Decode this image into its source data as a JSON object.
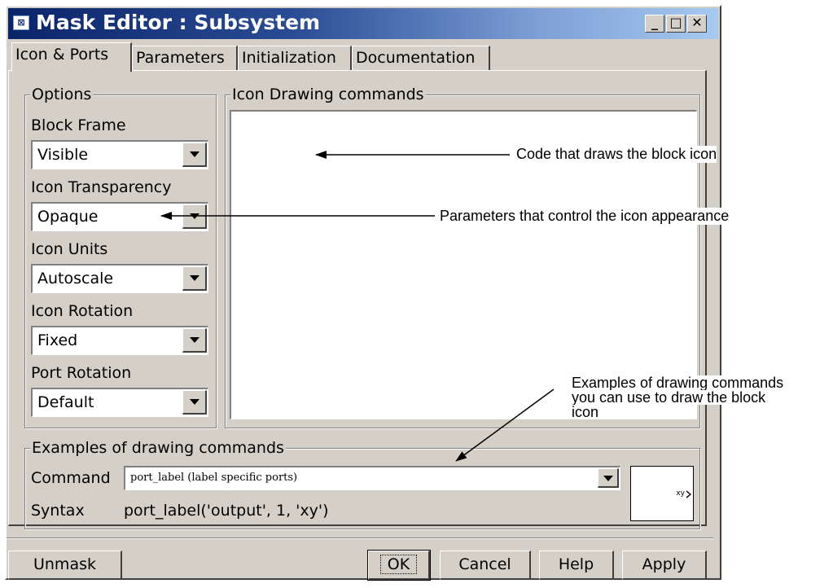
{
  "window": {
    "title": "Mask Editor : Subsystem",
    "controls": {
      "minimize": "_",
      "maximize": "□",
      "close": "✕"
    }
  },
  "tabs": [
    {
      "label": "Icon & Ports",
      "active": true
    },
    {
      "label": "Parameters",
      "active": false
    },
    {
      "label": "Initialization",
      "active": false
    },
    {
      "label": "Documentation",
      "active": false
    }
  ],
  "options": {
    "legend": "Options",
    "block_frame": {
      "label": "Block Frame",
      "value": "Visible"
    },
    "icon_transparency": {
      "label": "Icon Transparency",
      "value": "Opaque"
    },
    "icon_units": {
      "label": "Icon Units",
      "value": "Autoscale"
    },
    "icon_rotation": {
      "label": "Icon Rotation",
      "value": "Fixed"
    },
    "port_rotation": {
      "label": "Port Rotation",
      "value": "Default"
    }
  },
  "drawing": {
    "legend": "Icon Drawing commands",
    "value": ""
  },
  "examples": {
    "legend": "Examples of drawing commands",
    "command_label": "Command",
    "command_value": "port_label (label specific ports)",
    "syntax_label": "Syntax",
    "syntax_value": "port_label('output', 1, 'xy')",
    "preview_port_label": "xy"
  },
  "buttons": {
    "unmask": "Unmask",
    "ok": "OK",
    "cancel": "Cancel",
    "help": "Help",
    "apply": "Apply"
  },
  "annotations": {
    "code": "Code that draws the block icon",
    "params": "Parameters that control the icon appearance",
    "examples_line1": "Examples of drawing commands",
    "examples_line2": "you can use to draw the block",
    "examples_line3": "icon"
  }
}
